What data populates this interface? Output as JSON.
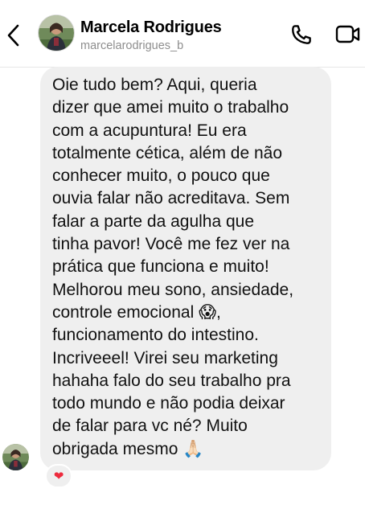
{
  "header": {
    "contact_name": "Marcela Rodrigues",
    "username": "marcelarodrigues_b",
    "back_icon": "chevron-left-icon",
    "call_icon": "phone-icon",
    "video_icon": "video-camera-icon"
  },
  "message": {
    "text": "Oie tudo bem? Aqui, queria\ndizer que amei muito o trabalho\ncom a acupuntura! Eu era\ntotalmente cética, além de não\nconhecer muito, o pouco que\nouvia falar não acreditava. Sem\nfalar a parte da agulha que\ntinha pavor! Você me fez ver na\nprática que funciona e muito!\nMelhorou meu sono, ansiedade,\ncontrole emocional 😱,\nfuncionamento do intestino.\nIncriveeel! Virei seu marketing\nhahaha falo do seu trabalho pra\ntodo mundo e não podia deixar\nde falar para vc né? Muito\nobrigada mesmo 🙏🏻",
    "reaction": "❤",
    "reaction_icon": "heart-reaction-icon"
  },
  "colors": {
    "bubble": "#efefef",
    "username": "#8e8e8e",
    "heart": "#ed2b3d"
  }
}
